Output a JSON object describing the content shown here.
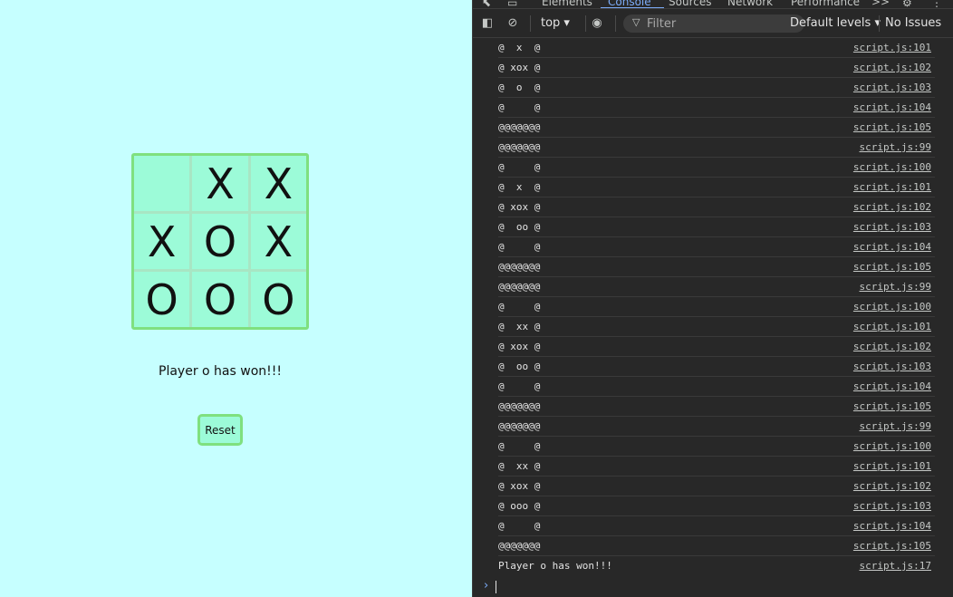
{
  "game": {
    "board": [
      "",
      "X",
      "X",
      "X",
      "O",
      "X",
      "O",
      "O",
      "O"
    ],
    "status": "Player o has won!!!",
    "reset_label": "Reset"
  },
  "devtools": {
    "tabs": [
      "Elements",
      "Console",
      "Sources",
      "Network",
      "Performance"
    ],
    "active_tab": "Console",
    "more_tabs": ">>",
    "context": "top ▾",
    "filter_placeholder": "Filter",
    "levels": "Default levels ▾",
    "issues": "No Issues",
    "logs": [
      {
        "msg": "@  x  @",
        "src": "script.js:101"
      },
      {
        "msg": "@ xox @",
        "src": "script.js:102"
      },
      {
        "msg": "@  o  @",
        "src": "script.js:103"
      },
      {
        "msg": "@     @",
        "src": "script.js:104"
      },
      {
        "msg": "@@@@@@@",
        "src": "script.js:105"
      },
      {
        "msg": "@@@@@@@",
        "src": "script.js:99"
      },
      {
        "msg": "@     @",
        "src": "script.js:100"
      },
      {
        "msg": "@  x  @",
        "src": "script.js:101"
      },
      {
        "msg": "@ xox @",
        "src": "script.js:102"
      },
      {
        "msg": "@  oo @",
        "src": "script.js:103"
      },
      {
        "msg": "@     @",
        "src": "script.js:104"
      },
      {
        "msg": "@@@@@@@",
        "src": "script.js:105"
      },
      {
        "msg": "@@@@@@@",
        "src": "script.js:99"
      },
      {
        "msg": "@     @",
        "src": "script.js:100"
      },
      {
        "msg": "@  xx @",
        "src": "script.js:101"
      },
      {
        "msg": "@ xox @",
        "src": "script.js:102"
      },
      {
        "msg": "@  oo @",
        "src": "script.js:103"
      },
      {
        "msg": "@     @",
        "src": "script.js:104"
      },
      {
        "msg": "@@@@@@@",
        "src": "script.js:105"
      },
      {
        "msg": "@@@@@@@",
        "src": "script.js:99"
      },
      {
        "msg": "@     @",
        "src": "script.js:100"
      },
      {
        "msg": "@  xx @",
        "src": "script.js:101"
      },
      {
        "msg": "@ xox @",
        "src": "script.js:102"
      },
      {
        "msg": "@ ooo @",
        "src": "script.js:103"
      },
      {
        "msg": "@     @",
        "src": "script.js:104"
      },
      {
        "msg": "@@@@@@@",
        "src": "script.js:105"
      },
      {
        "msg": "Player o has won!!!",
        "src": "script.js:17"
      }
    ]
  },
  "colors": {
    "page_bg": "#c6ffff",
    "cell_bg": "#9cfbd8",
    "board_border": "#7fe07f",
    "devtools_bg": "#282828",
    "accent": "#7cacf8"
  }
}
